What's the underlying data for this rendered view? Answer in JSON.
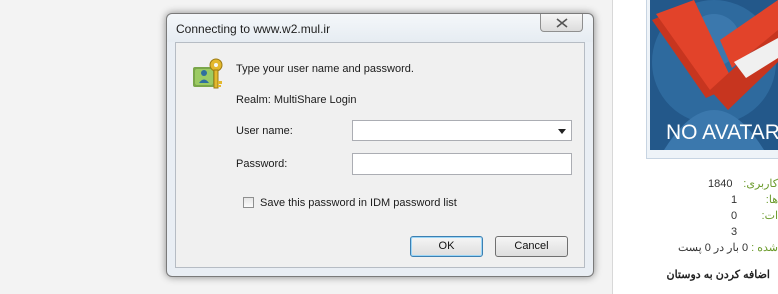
{
  "dialog": {
    "title": "Connecting to www.w2.mul.ir",
    "prompt": "Type your user name and password.",
    "realm": "Realm: MultiShare Login",
    "username_label": "User name:",
    "username_value": "",
    "password_label": "Password:",
    "password_value": "",
    "save_checkbox_label": "Save this password in IDM password list",
    "save_checked": false,
    "ok_label": "OK",
    "cancel_label": "Cancel"
  },
  "profile": {
    "avatar_text": "NO AVATAR",
    "stats": [
      {
        "label": "کاربری:",
        "value": "1840"
      },
      {
        "label": "ها:",
        "value": "1"
      },
      {
        "label": "ات:",
        "value": "0"
      },
      {
        "label": "",
        "value": "3"
      }
    ],
    "thanks_label": "شده :",
    "thanks_value": "0 بار در 0 پست",
    "add_friend": "اضافه کردن به دوستان"
  },
  "colors": {
    "avatar_bg": "#23588a",
    "avatar_accent": "#e2432a",
    "stat_label": "#6a9a2a"
  },
  "icons": [
    "close-icon",
    "key-icon",
    "dropdown-arrow-icon"
  ]
}
